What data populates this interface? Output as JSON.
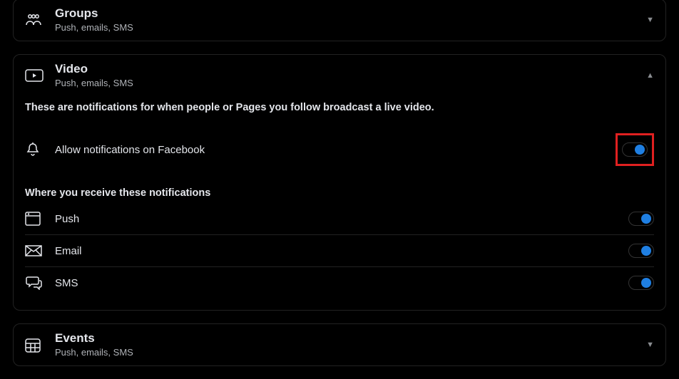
{
  "cards": {
    "groups": {
      "title": "Groups",
      "sub": "Push, emails, SMS"
    },
    "video": {
      "title": "Video",
      "sub": "Push, emails, SMS",
      "description": "These are notifications for when people or Pages you follow broadcast a live video.",
      "allow_label": "Allow notifications on Facebook",
      "where_heading": "Where you receive these notifications",
      "channels": {
        "push": "Push",
        "email": "Email",
        "sms": "SMS"
      }
    },
    "events": {
      "title": "Events",
      "sub": "Push, emails, SMS"
    }
  }
}
